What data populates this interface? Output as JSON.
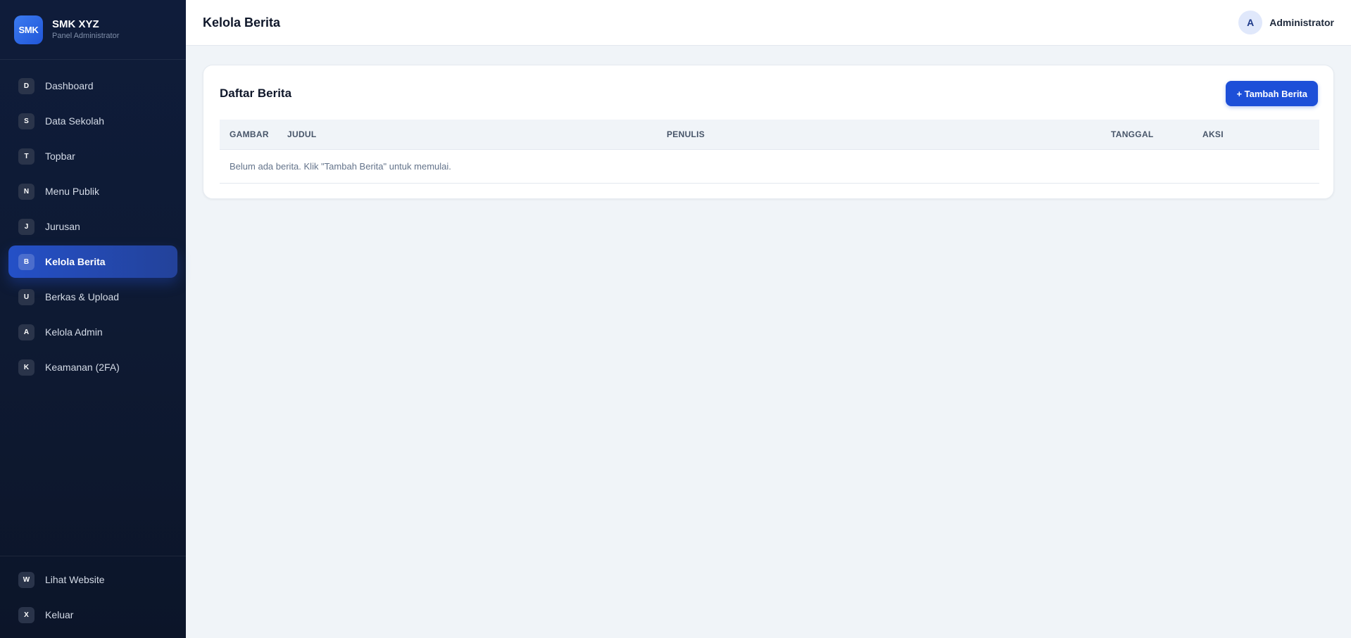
{
  "brand": {
    "logo_text": "SMK",
    "title": "SMK XYZ",
    "subtitle": "Panel Administrator"
  },
  "sidebar": {
    "items": [
      {
        "badge": "D",
        "label": "Dashboard"
      },
      {
        "badge": "S",
        "label": "Data Sekolah"
      },
      {
        "badge": "T",
        "label": "Topbar"
      },
      {
        "badge": "N",
        "label": "Menu Publik"
      },
      {
        "badge": "J",
        "label": "Jurusan"
      },
      {
        "badge": "B",
        "label": "Kelola Berita",
        "active": true
      },
      {
        "badge": "U",
        "label": "Berkas & Upload"
      },
      {
        "badge": "A",
        "label": "Kelola Admin"
      },
      {
        "badge": "K",
        "label": "Keamanan (2FA)"
      }
    ],
    "bottom_items": [
      {
        "badge": "W",
        "label": "Lihat Website"
      },
      {
        "badge": "X",
        "label": "Keluar"
      }
    ]
  },
  "header": {
    "title": "Kelola Berita",
    "user_initial": "A",
    "user_name": "Administrator"
  },
  "card": {
    "title": "Daftar Berita",
    "add_button_label": "+ Tambah Berita",
    "columns": [
      "GAMBAR",
      "JUDUL",
      "PENULIS",
      "TANGGAL",
      "AKSI"
    ],
    "empty_message": "Belum ada berita. Klik \"Tambah Berita\" untuk memulai."
  },
  "colors": {
    "accent": "#1d4fd8",
    "sidebar_bg": "#0f1c3a",
    "page_bg": "#f0f4f8"
  }
}
